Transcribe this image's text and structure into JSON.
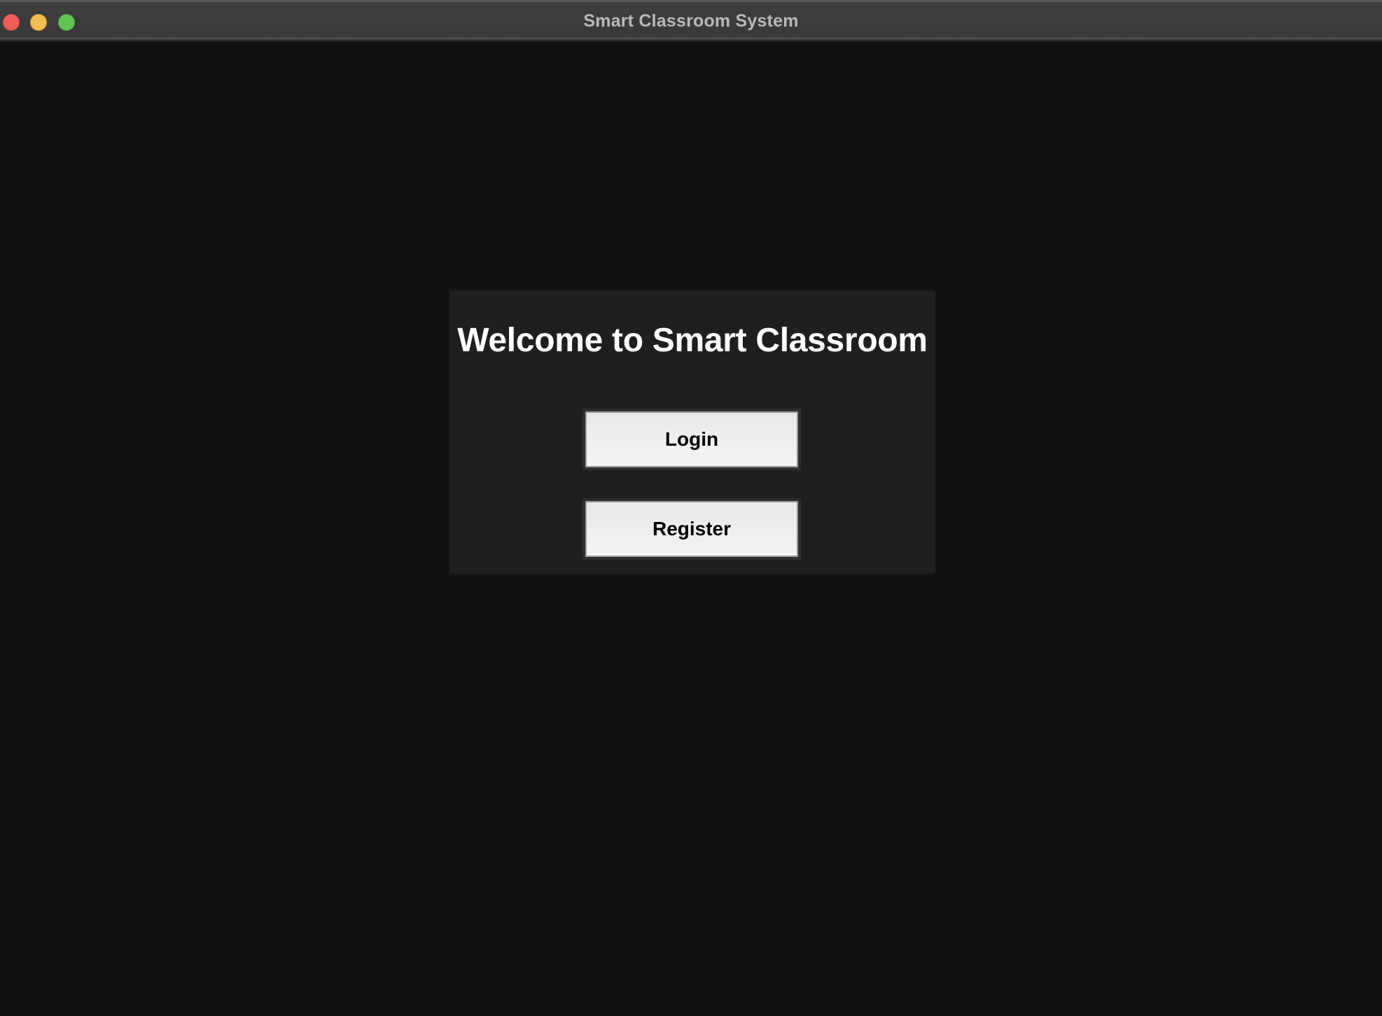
{
  "window": {
    "title": "Smart Classroom System",
    "controls": {
      "close_icon": "close-traffic-light",
      "minimize_icon": "minimize-traffic-light",
      "zoom_icon": "zoom-traffic-light"
    }
  },
  "welcome": {
    "heading": "Welcome to Smart Classroom",
    "login_label": "Login",
    "register_label": "Register"
  },
  "colors": {
    "background": "#121212",
    "panel": "#1f1f1f",
    "titlebar": "#3b3b3b",
    "close": "#ee5e58",
    "minimize": "#f4bd4f",
    "zoom": "#5fc454",
    "button_face": "#efefef"
  }
}
